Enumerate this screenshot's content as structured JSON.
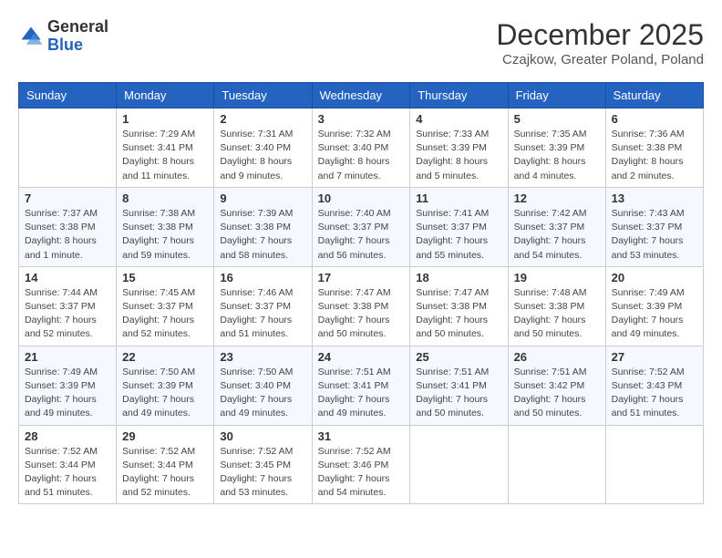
{
  "header": {
    "logo_general": "General",
    "logo_blue": "Blue",
    "month": "December 2025",
    "location": "Czajkow, Greater Poland, Poland"
  },
  "days_of_week": [
    "Sunday",
    "Monday",
    "Tuesday",
    "Wednesday",
    "Thursday",
    "Friday",
    "Saturday"
  ],
  "weeks": [
    [
      {
        "day": "",
        "info": ""
      },
      {
        "day": "1",
        "info": "Sunrise: 7:29 AM\nSunset: 3:41 PM\nDaylight: 8 hours\nand 11 minutes."
      },
      {
        "day": "2",
        "info": "Sunrise: 7:31 AM\nSunset: 3:40 PM\nDaylight: 8 hours\nand 9 minutes."
      },
      {
        "day": "3",
        "info": "Sunrise: 7:32 AM\nSunset: 3:40 PM\nDaylight: 8 hours\nand 7 minutes."
      },
      {
        "day": "4",
        "info": "Sunrise: 7:33 AM\nSunset: 3:39 PM\nDaylight: 8 hours\nand 5 minutes."
      },
      {
        "day": "5",
        "info": "Sunrise: 7:35 AM\nSunset: 3:39 PM\nDaylight: 8 hours\nand 4 minutes."
      },
      {
        "day": "6",
        "info": "Sunrise: 7:36 AM\nSunset: 3:38 PM\nDaylight: 8 hours\nand 2 minutes."
      }
    ],
    [
      {
        "day": "7",
        "info": "Sunrise: 7:37 AM\nSunset: 3:38 PM\nDaylight: 8 hours\nand 1 minute."
      },
      {
        "day": "8",
        "info": "Sunrise: 7:38 AM\nSunset: 3:38 PM\nDaylight: 7 hours\nand 59 minutes."
      },
      {
        "day": "9",
        "info": "Sunrise: 7:39 AM\nSunset: 3:38 PM\nDaylight: 7 hours\nand 58 minutes."
      },
      {
        "day": "10",
        "info": "Sunrise: 7:40 AM\nSunset: 3:37 PM\nDaylight: 7 hours\nand 56 minutes."
      },
      {
        "day": "11",
        "info": "Sunrise: 7:41 AM\nSunset: 3:37 PM\nDaylight: 7 hours\nand 55 minutes."
      },
      {
        "day": "12",
        "info": "Sunrise: 7:42 AM\nSunset: 3:37 PM\nDaylight: 7 hours\nand 54 minutes."
      },
      {
        "day": "13",
        "info": "Sunrise: 7:43 AM\nSunset: 3:37 PM\nDaylight: 7 hours\nand 53 minutes."
      }
    ],
    [
      {
        "day": "14",
        "info": "Sunrise: 7:44 AM\nSunset: 3:37 PM\nDaylight: 7 hours\nand 52 minutes."
      },
      {
        "day": "15",
        "info": "Sunrise: 7:45 AM\nSunset: 3:37 PM\nDaylight: 7 hours\nand 52 minutes."
      },
      {
        "day": "16",
        "info": "Sunrise: 7:46 AM\nSunset: 3:37 PM\nDaylight: 7 hours\nand 51 minutes."
      },
      {
        "day": "17",
        "info": "Sunrise: 7:47 AM\nSunset: 3:38 PM\nDaylight: 7 hours\nand 50 minutes."
      },
      {
        "day": "18",
        "info": "Sunrise: 7:47 AM\nSunset: 3:38 PM\nDaylight: 7 hours\nand 50 minutes."
      },
      {
        "day": "19",
        "info": "Sunrise: 7:48 AM\nSunset: 3:38 PM\nDaylight: 7 hours\nand 50 minutes."
      },
      {
        "day": "20",
        "info": "Sunrise: 7:49 AM\nSunset: 3:39 PM\nDaylight: 7 hours\nand 49 minutes."
      }
    ],
    [
      {
        "day": "21",
        "info": "Sunrise: 7:49 AM\nSunset: 3:39 PM\nDaylight: 7 hours\nand 49 minutes."
      },
      {
        "day": "22",
        "info": "Sunrise: 7:50 AM\nSunset: 3:39 PM\nDaylight: 7 hours\nand 49 minutes."
      },
      {
        "day": "23",
        "info": "Sunrise: 7:50 AM\nSunset: 3:40 PM\nDaylight: 7 hours\nand 49 minutes."
      },
      {
        "day": "24",
        "info": "Sunrise: 7:51 AM\nSunset: 3:41 PM\nDaylight: 7 hours\nand 49 minutes."
      },
      {
        "day": "25",
        "info": "Sunrise: 7:51 AM\nSunset: 3:41 PM\nDaylight: 7 hours\nand 50 minutes."
      },
      {
        "day": "26",
        "info": "Sunrise: 7:51 AM\nSunset: 3:42 PM\nDaylight: 7 hours\nand 50 minutes."
      },
      {
        "day": "27",
        "info": "Sunrise: 7:52 AM\nSunset: 3:43 PM\nDaylight: 7 hours\nand 51 minutes."
      }
    ],
    [
      {
        "day": "28",
        "info": "Sunrise: 7:52 AM\nSunset: 3:44 PM\nDaylight: 7 hours\nand 51 minutes."
      },
      {
        "day": "29",
        "info": "Sunrise: 7:52 AM\nSunset: 3:44 PM\nDaylight: 7 hours\nand 52 minutes."
      },
      {
        "day": "30",
        "info": "Sunrise: 7:52 AM\nSunset: 3:45 PM\nDaylight: 7 hours\nand 53 minutes."
      },
      {
        "day": "31",
        "info": "Sunrise: 7:52 AM\nSunset: 3:46 PM\nDaylight: 7 hours\nand 54 minutes."
      },
      {
        "day": "",
        "info": ""
      },
      {
        "day": "",
        "info": ""
      },
      {
        "day": "",
        "info": ""
      }
    ]
  ]
}
